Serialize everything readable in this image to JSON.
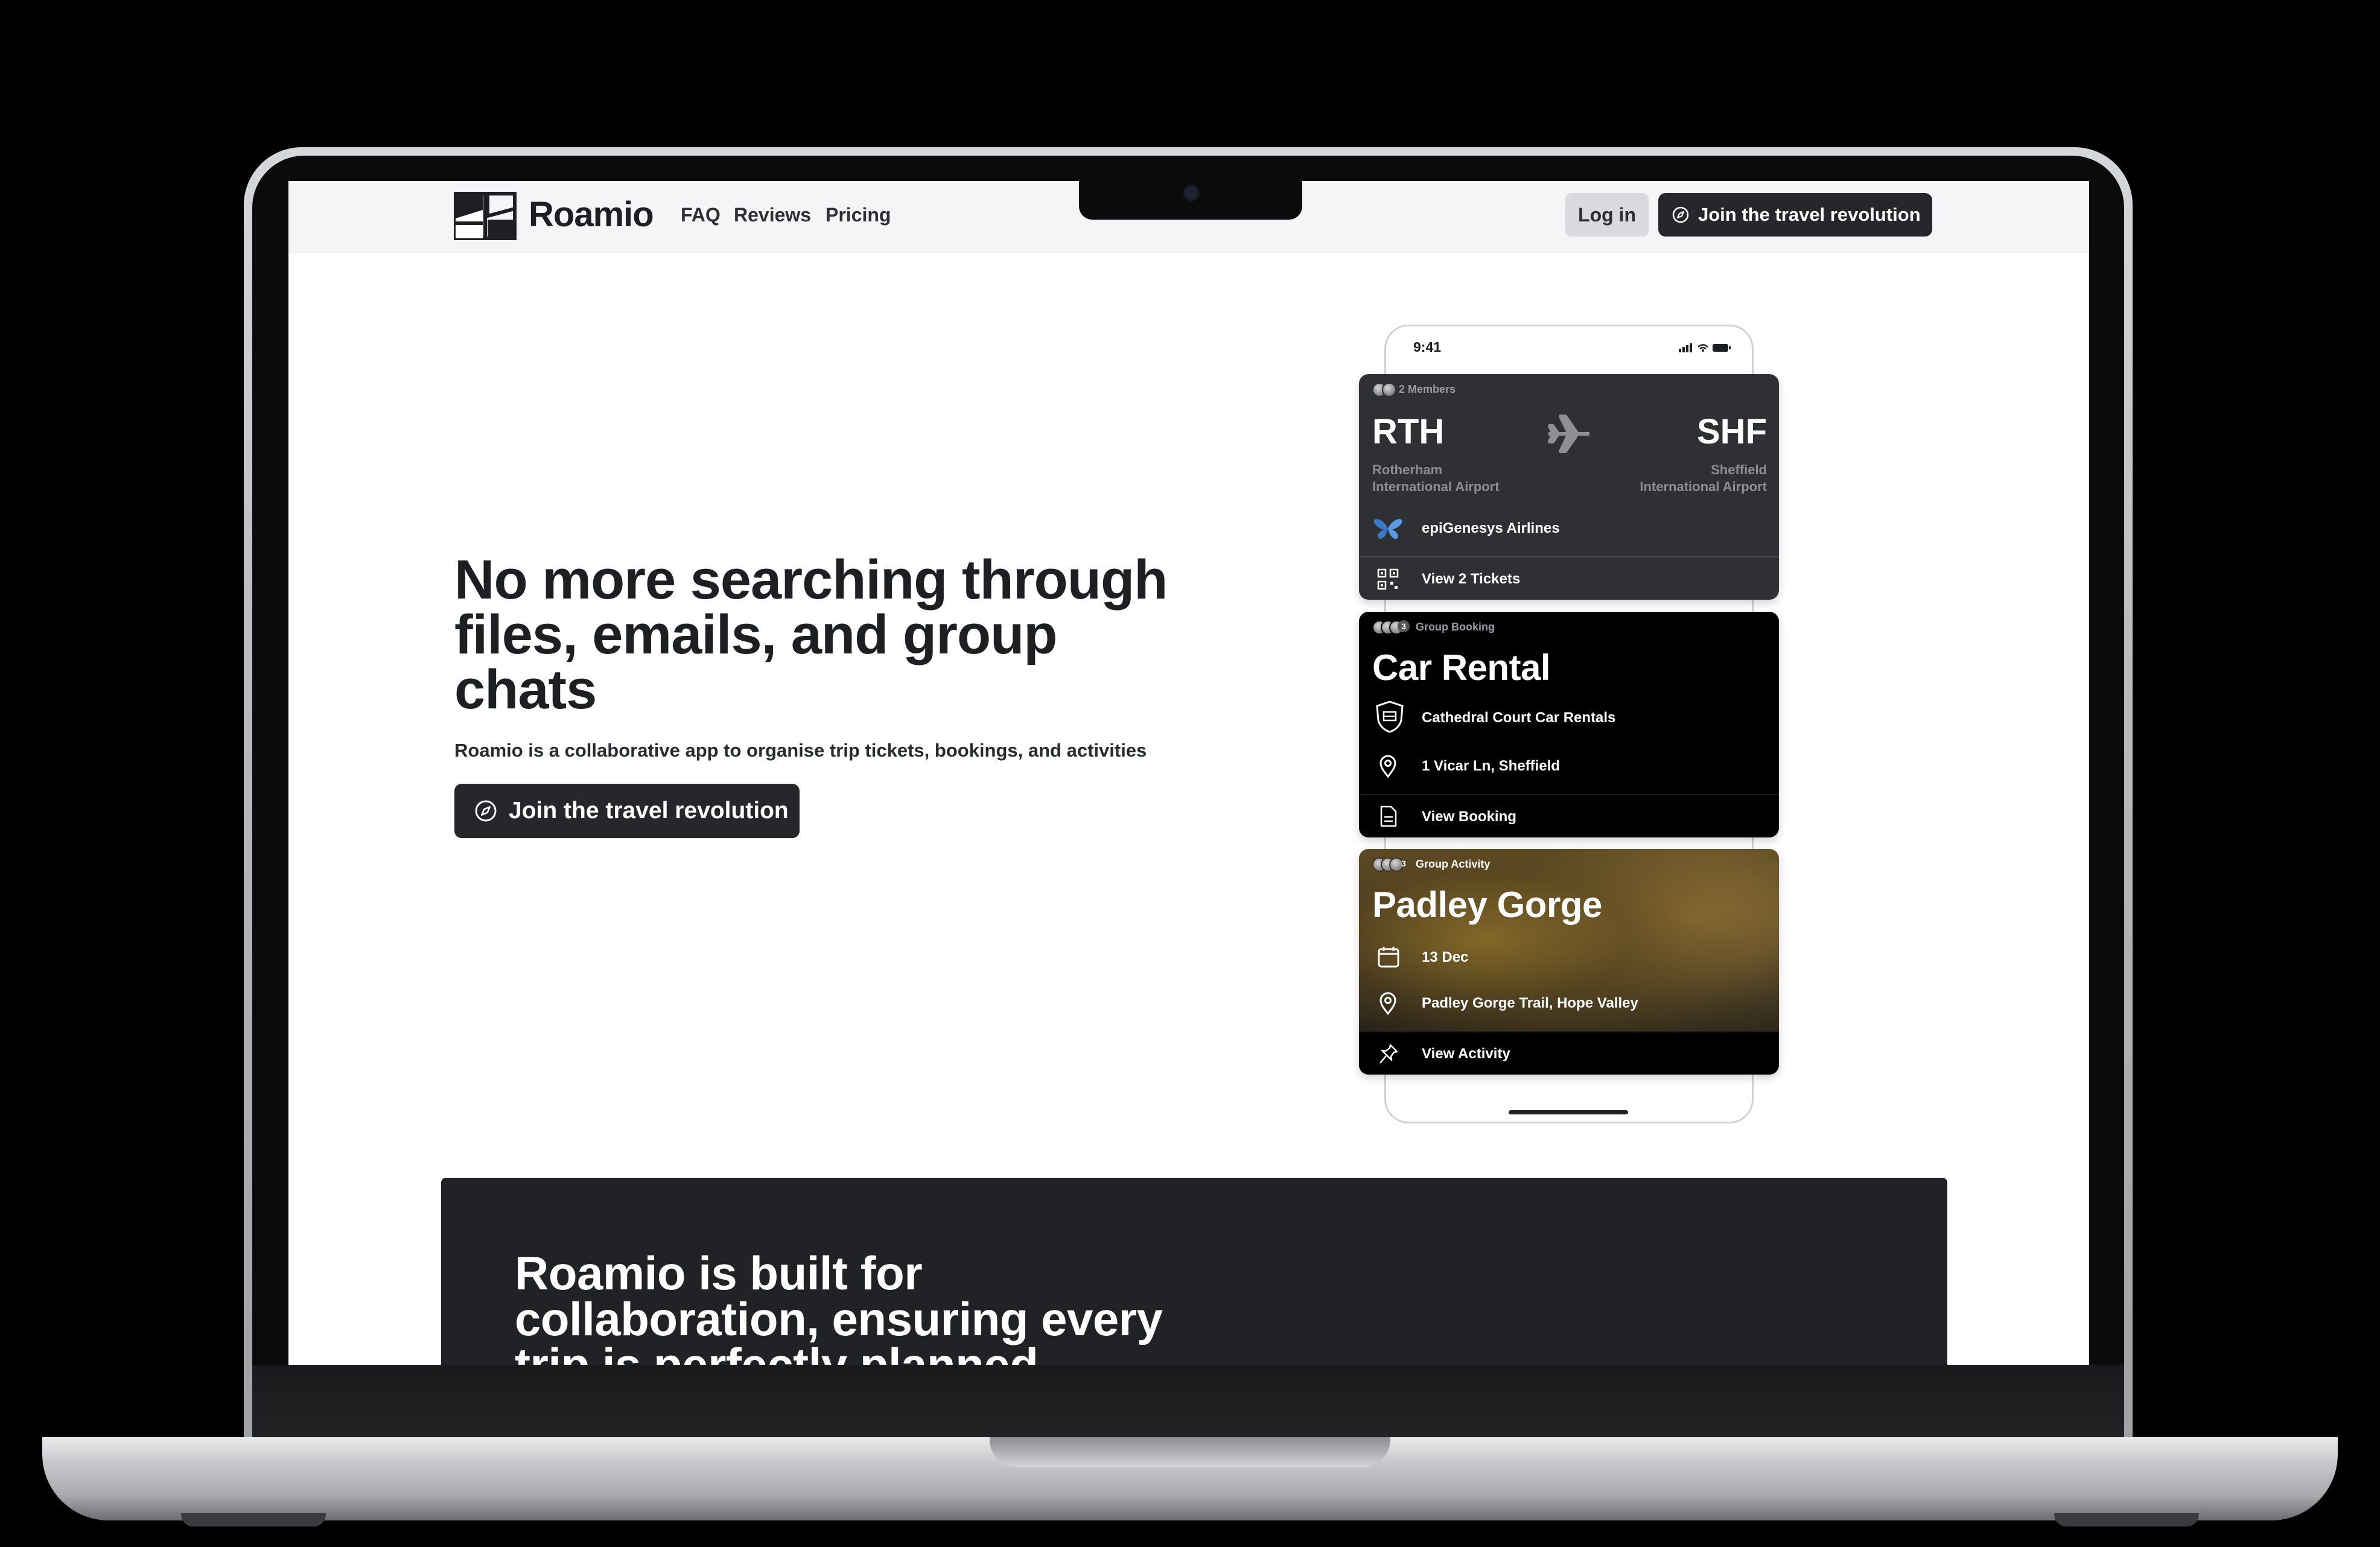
{
  "nav": {
    "brand": "Roamio",
    "links": [
      "FAQ",
      "Reviews",
      "Pricing"
    ],
    "login_label": "Log in",
    "cta_label": "Join the travel revolution"
  },
  "hero": {
    "headline": "No more searching through files, emails, and group chats",
    "subline": "Roamio is a collaborative app to organise trip tickets, bookings, and activities",
    "cta_label": "Join the travel revolution"
  },
  "phone": {
    "time": "9:41",
    "flight": {
      "members": "2 Members",
      "from_code": "RTH",
      "from_name_1": "Rotherham",
      "from_name_2": "International Airport",
      "to_code": "SHF",
      "to_name_1": "Sheffield",
      "to_name_2": "International Airport",
      "airline": "epiGenesys Airlines",
      "action": "View 2 Tickets"
    },
    "car": {
      "extra_count": "3",
      "tag": "Group Booking",
      "title": "Car Rental",
      "company": "Cathedral Court Car Rentals",
      "address": "1 Vicar Ln, Sheffield",
      "action": "View Booking"
    },
    "activity": {
      "extra_count": "3",
      "tag": "Group Activity",
      "title": "Padley Gorge",
      "date": "13 Dec",
      "location": "Padley Gorge Trail, Hope Valley",
      "action": "View Activity"
    }
  },
  "collab": {
    "title": "Roamio is built for collaboration, ensuring every trip is perfectly planned"
  },
  "colors": {
    "accent_dark": "#26272b",
    "section_dark": "#212226",
    "nav_bg": "#f4f5f6"
  }
}
